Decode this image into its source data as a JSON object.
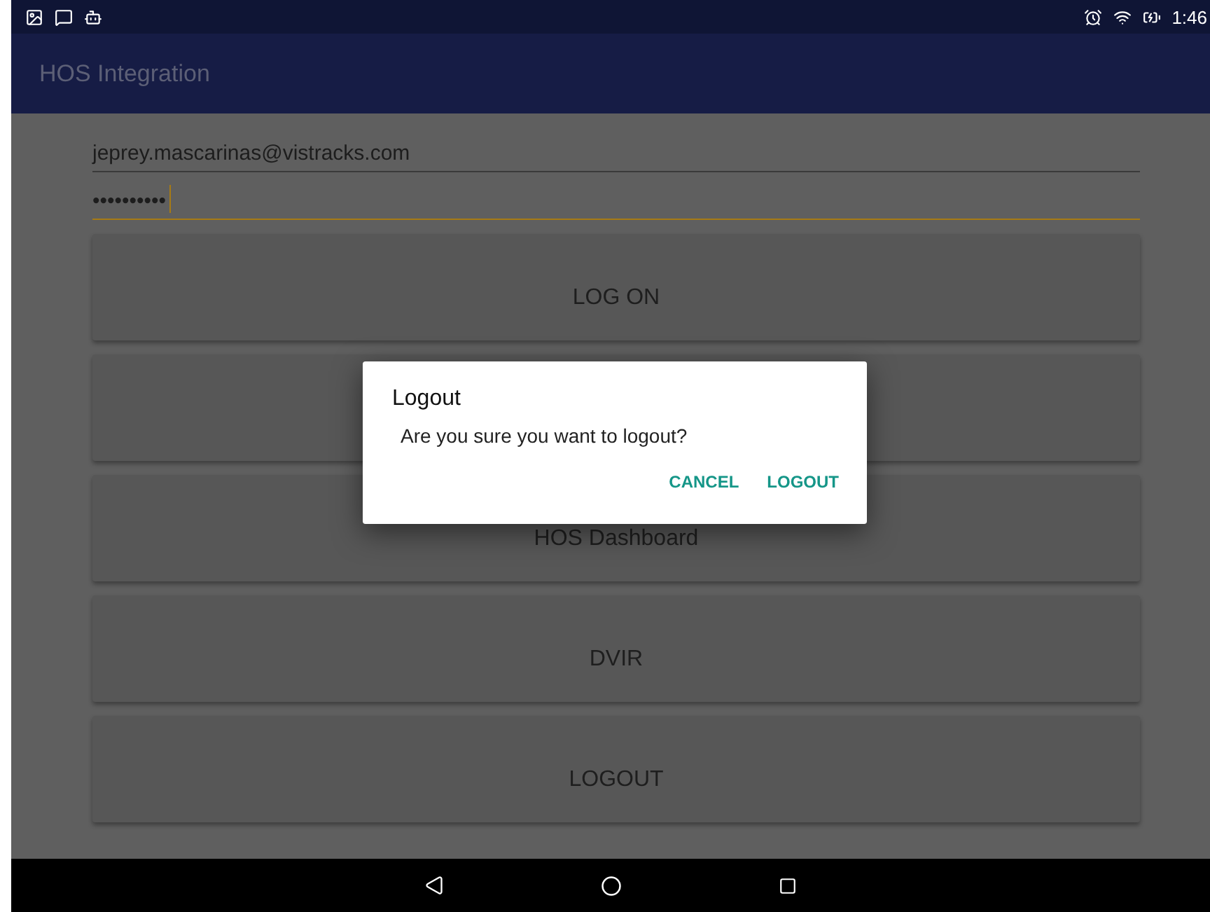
{
  "status_bar": {
    "time": "1:46"
  },
  "app_bar": {
    "title": "HOS Integration"
  },
  "form": {
    "email": {
      "value": "jeprey.mascarinas@vistracks.com"
    },
    "password": {
      "value": "••••••••••",
      "focused": true
    }
  },
  "buttons": [
    {
      "kind": "labeled",
      "label": "LOG ON"
    },
    {
      "kind": "covered"
    },
    {
      "kind": "labeled",
      "label": "HOS Dashboard"
    },
    {
      "kind": "labeled",
      "label": "DVIR"
    },
    {
      "kind": "labeled",
      "label": "LOGOUT"
    }
  ],
  "dialog": {
    "title": "Logout",
    "message": "Are you sure you want to logout?",
    "actions": [
      "CANCEL",
      "LOGOUT"
    ]
  }
}
